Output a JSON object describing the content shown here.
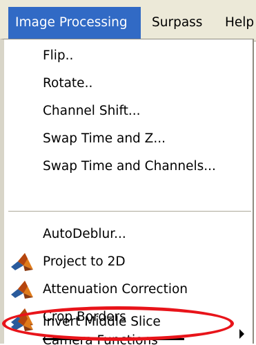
{
  "menubar": {
    "items": [
      {
        "label": "Image Processing"
      },
      {
        "label": "Surpass"
      },
      {
        "label": "Help"
      }
    ]
  },
  "dropdown": {
    "items": [
      {
        "label": "Flip.."
      },
      {
        "label": "Rotate.."
      },
      {
        "label": "Channel Shift..."
      },
      {
        "label": "Swap Time and Z..."
      },
      {
        "label": "Swap Time and Channels..."
      },
      {
        "label": "AutoDeblur..."
      },
      {
        "label": "Project to 2D",
        "icon": "matlab-icon"
      },
      {
        "label": "Attenuation Correction",
        "icon": "matlab-icon"
      },
      {
        "label": "Crop Borders",
        "icon": "matlab-icon"
      },
      {
        "label": "Camera Functions",
        "submenu": true
      },
      {
        "label": "Invert Middle Slice",
        "icon": "matlab-icon",
        "highlighted": true
      }
    ]
  },
  "colors": {
    "menu_highlight": "#316ac5",
    "annotation_ring": "#e8141a",
    "matlab_icon_orange": "#e07b1a"
  }
}
